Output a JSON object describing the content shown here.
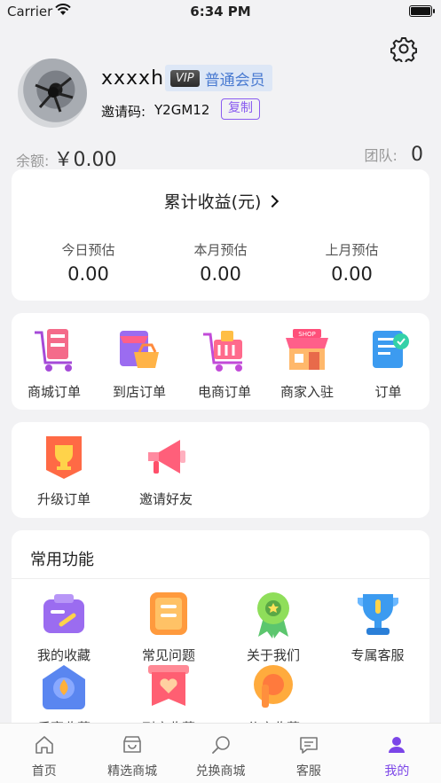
{
  "status_bar": {
    "carrier": "Carrier",
    "time": "6:34 PM"
  },
  "profile": {
    "username": "xxxxh",
    "vip_tag": "VIP",
    "vip_level": "普通会员",
    "invite_label": "邀请码:",
    "invite_code": "Y2GM12",
    "copy_label": "复制"
  },
  "balance": {
    "label": "余额:",
    "value": "￥0.00"
  },
  "team": {
    "label": "团队:",
    "value": "0"
  },
  "earnings": {
    "title": "累计收益(元)",
    "stats": [
      {
        "label": "今日预估",
        "value": "0.00"
      },
      {
        "label": "本月预估",
        "value": "0.00"
      },
      {
        "label": "上月预估",
        "value": "0.00"
      }
    ]
  },
  "orders": [
    {
      "label": "商城订单",
      "icon": "cart-icon"
    },
    {
      "label": "到店订单",
      "icon": "store-basket-icon"
    },
    {
      "label": "电商订单",
      "icon": "ecommerce-cart-icon"
    },
    {
      "label": "商家入驻",
      "icon": "shop-icon"
    },
    {
      "label": "订单",
      "icon": "order-scroll-icon"
    }
  ],
  "extras": [
    {
      "label": "升级订单",
      "icon": "trophy-banner-icon"
    },
    {
      "label": "邀请好友",
      "icon": "megaphone-icon"
    }
  ],
  "functions": {
    "title": "常用功能",
    "items": [
      {
        "label": "我的收藏",
        "icon": "favorites-icon"
      },
      {
        "label": "常见问题",
        "icon": "faq-icon"
      },
      {
        "label": "关于我们",
        "icon": "about-medal-icon"
      },
      {
        "label": "专属客服",
        "icon": "support-trophy-icon"
      },
      {
        "label": "乐享收藏",
        "icon": "flame-house-icon"
      },
      {
        "label": "到店收藏",
        "icon": "heart-banner-icon"
      },
      {
        "label": "分店收藏",
        "icon": "branch-icon"
      }
    ]
  },
  "tabs": [
    {
      "label": "首页",
      "icon": "home-icon"
    },
    {
      "label": "精选商城",
      "icon": "mall-icon"
    },
    {
      "label": "兑换商城",
      "icon": "exchange-search-icon"
    },
    {
      "label": "客服",
      "icon": "chat-icon"
    },
    {
      "label": "我的",
      "icon": "profile-icon"
    }
  ],
  "colors": {
    "accent": "#7b45e8",
    "vip": "#4a7bd1",
    "background": "#f2f2f4"
  }
}
